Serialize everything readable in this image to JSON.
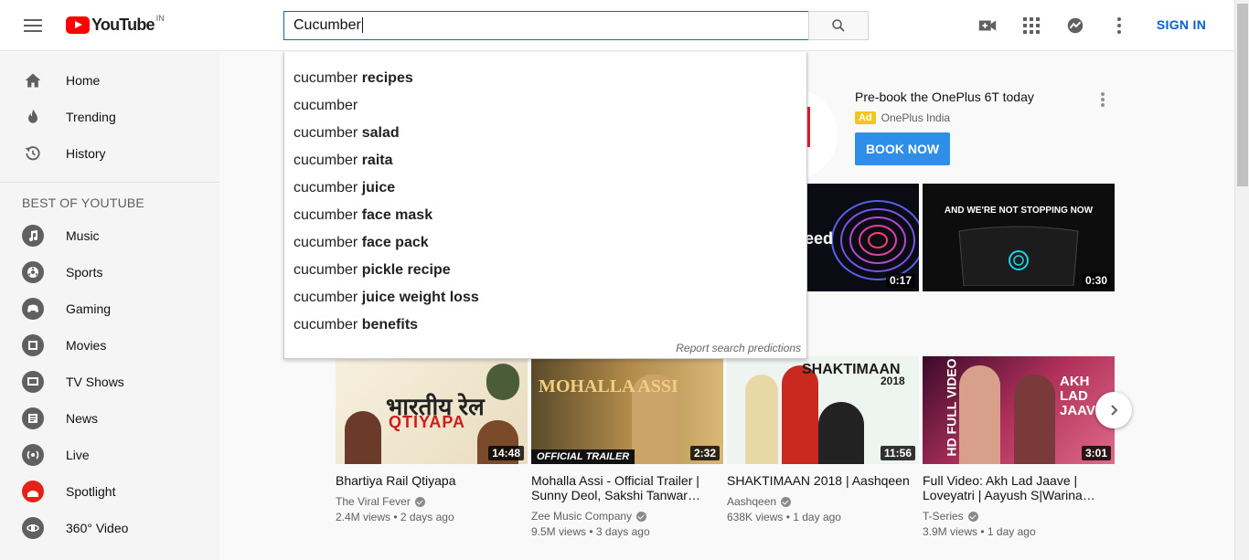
{
  "header": {
    "logo_text": "YouTube",
    "logo_country": "IN",
    "search_value": "Cucumber",
    "sign_in_label": "SIGN IN",
    "icons": [
      "menu-icon",
      "search-icon",
      "create-video-icon",
      "apps-icon",
      "messages-icon",
      "more-vert-icon"
    ]
  },
  "suggestions": {
    "items": [
      {
        "prefix": "cucumber",
        "suffix": "recipes"
      },
      {
        "prefix": "cucumber",
        "suffix": ""
      },
      {
        "prefix": "cucumber",
        "suffix": "salad"
      },
      {
        "prefix": "cucumber",
        "suffix": "raita"
      },
      {
        "prefix": "cucumber",
        "suffix": "juice"
      },
      {
        "prefix": "cucumber",
        "suffix": "face mask"
      },
      {
        "prefix": "cucumber",
        "suffix": "face pack"
      },
      {
        "prefix": "cucumber",
        "suffix": "pickle recipe"
      },
      {
        "prefix": "cucumber",
        "suffix": "juice weight loss"
      },
      {
        "prefix": "cucumber",
        "suffix": "benefits"
      }
    ],
    "report_label": "Report search predictions"
  },
  "sidebar": {
    "items": [
      {
        "label": "Home",
        "icon": "home-icon"
      },
      {
        "label": "Trending",
        "icon": "trending-icon"
      },
      {
        "label": "History",
        "icon": "history-icon"
      }
    ],
    "section_heading": "BEST OF YOUTUBE",
    "best_items": [
      {
        "label": "Music",
        "icon": "music-icon"
      },
      {
        "label": "Sports",
        "icon": "sports-icon"
      },
      {
        "label": "Gaming",
        "icon": "gaming-icon"
      },
      {
        "label": "Movies",
        "icon": "movies-icon"
      },
      {
        "label": "TV Shows",
        "icon": "tv-shows-icon"
      },
      {
        "label": "News",
        "icon": "news-icon"
      },
      {
        "label": "Live",
        "icon": "live-icon"
      },
      {
        "label": "Spotlight",
        "icon": "spotlight-icon"
      },
      {
        "label": "360° Video",
        "icon": "360-video-icon"
      }
    ]
  },
  "ad": {
    "title": "Pre-book the OnePlus 6T today",
    "badge": "Ad",
    "channel": "OnePlus India",
    "button_label": "BOOK NOW",
    "videos": [
      {
        "duration": "0:17",
        "overlay_text": "eed"
      },
      {
        "duration": "0:30",
        "overlay_text": "AND WE'RE NOT STOPPING NOW"
      }
    ]
  },
  "videos": [
    {
      "title": "Bhartiya Rail Qtiyapa",
      "channel": "The Viral Fever",
      "views": "2.4M views",
      "age": "2 days ago",
      "duration": "14:48",
      "thumb_text": "भारतीय रेल",
      "thumb_sub": "QTIYAPA"
    },
    {
      "title": "Mohalla Assi - Official Trailer | Sunny Deol, Sakshi Tanwar…",
      "channel": "Zee Music Company",
      "views": "9.5M views",
      "age": "3 days ago",
      "duration": "2:32",
      "thumb_text": "MOHALLA ASSI",
      "thumb_sub": "OFFICIAL TRAILER"
    },
    {
      "title": "SHAKTIMAAN 2018 | Aashqeen",
      "channel": "Aashqeen",
      "views": "638K views",
      "age": "1 day ago",
      "duration": "11:56",
      "thumb_text": "SHAKTIMAAN",
      "thumb_sub": "2018"
    },
    {
      "title": "Full Video: Akh Lad Jaave | Loveyatri | Aayush S|Warina…",
      "channel": "T-Series",
      "views": "3.9M views",
      "age": "1 day ago",
      "duration": "3:01",
      "thumb_text": "AKH LAD JAAVE",
      "thumb_sub": "HD FULL VIDEO"
    }
  ],
  "colors": {
    "brand_red": "#ff0000",
    "link_blue": "#065fd4",
    "ad_button": "#2f8fe8",
    "ad_badge": "#f2c61f"
  }
}
